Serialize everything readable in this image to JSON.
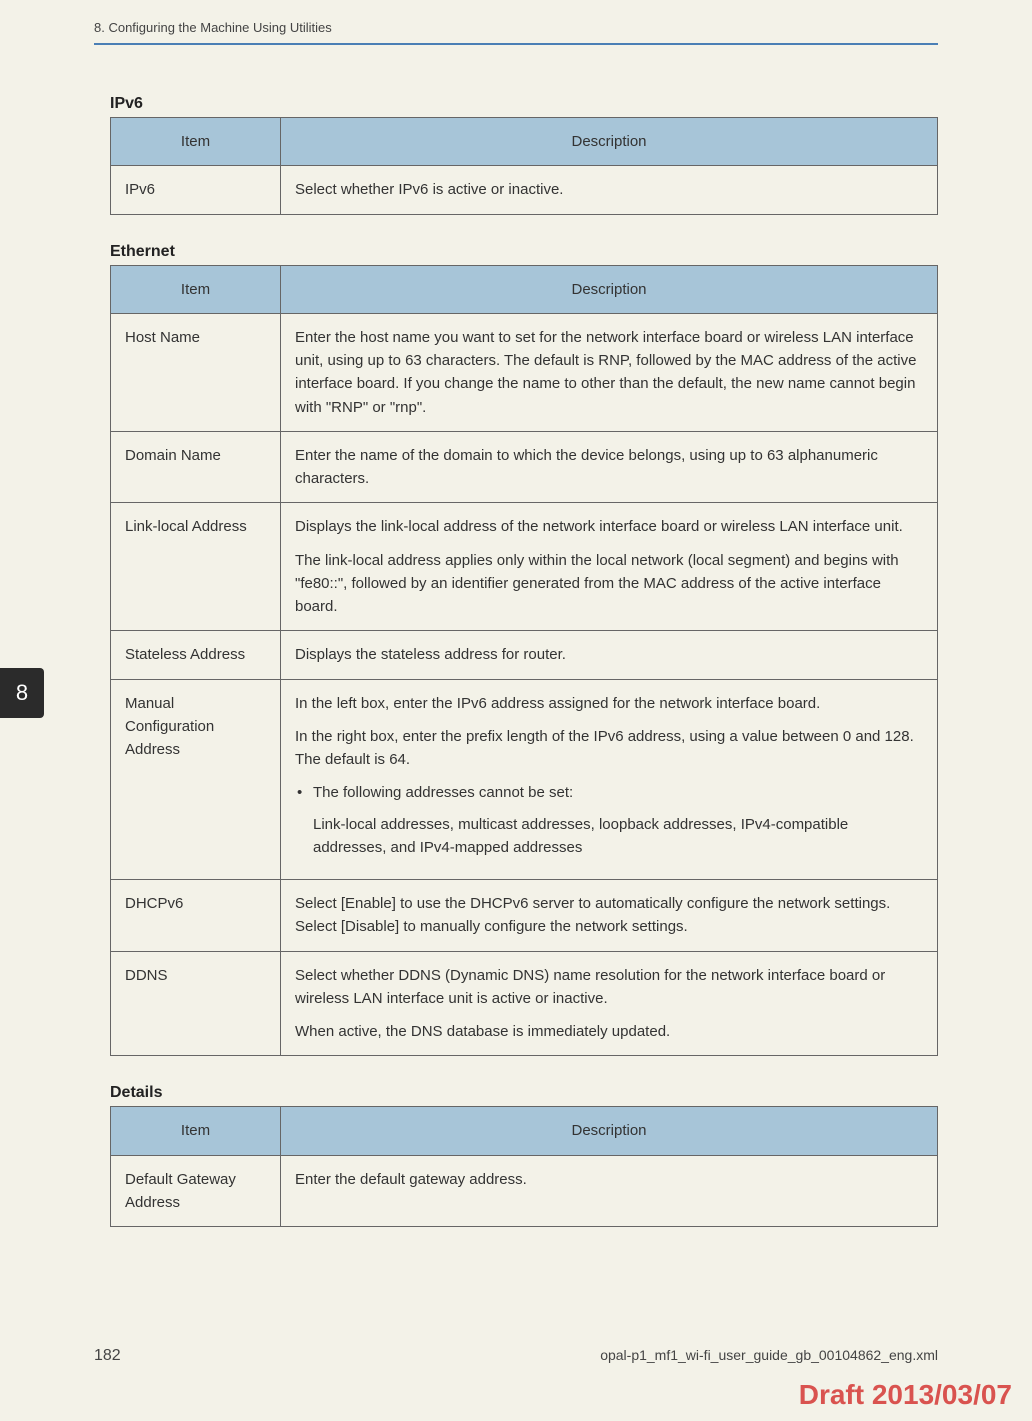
{
  "header": {
    "chapter": "8. Configuring the Machine Using Utilities"
  },
  "sideTab": {
    "number": "8"
  },
  "sections": {
    "ipv6": {
      "title": "IPv6",
      "headers": {
        "item": "Item",
        "description": "Description"
      },
      "rows": [
        {
          "item": "IPv6",
          "description": "Select whether IPv6 is active or inactive."
        }
      ]
    },
    "ethernet": {
      "title": "Ethernet",
      "headers": {
        "item": "Item",
        "description": "Description"
      },
      "rows": [
        {
          "item": "Host Name",
          "description": "Enter the host name you want to set for the network interface board or wireless LAN interface unit, using up to 63 characters. The default is RNP, followed by the MAC address of the active interface board. If you change the name to other than the default, the new name cannot begin with \"RNP\" or \"rnp\"."
        },
        {
          "item": "Domain Name",
          "description": "Enter the name of the domain to which the device belongs, using up to 63 alphanumeric characters."
        },
        {
          "item": "Link-local Address",
          "description_p1": "Displays the link-local address of the network interface board or wireless LAN interface unit.",
          "description_p2": "The link-local address applies only within the local network (local segment) and begins with \"fe80::\", followed by an identifier generated from the MAC address of the active interface board."
        },
        {
          "item": "Stateless Address",
          "description": "Displays the stateless address for router."
        },
        {
          "item": "Manual Configuration Address",
          "description_p1": "In the left box, enter the IPv6 address assigned for the network interface board.",
          "description_p2": "In the right box, enter the prefix length of the IPv6 address, using a value between 0 and 128. The default is 64.",
          "bullet": "The following addresses cannot be set:",
          "bullet_sub": "Link-local addresses, multicast addresses, loopback addresses, IPv4-compatible addresses, and IPv4-mapped addresses"
        },
        {
          "item": "DHCPv6",
          "description": "Select [Enable] to use the DHCPv6 server to automatically configure the network settings. Select [Disable] to manually configure the network settings."
        },
        {
          "item": "DDNS",
          "description_p1": "Select whether DDNS (Dynamic DNS) name resolution for the network interface board or wireless LAN interface unit is active or inactive.",
          "description_p2": "When active, the DNS database is immediately updated."
        }
      ]
    },
    "details": {
      "title": "Details",
      "headers": {
        "item": "Item",
        "description": "Description"
      },
      "rows": [
        {
          "item": "Default Gateway Address",
          "description": "Enter the default gateway address."
        }
      ]
    }
  },
  "footer": {
    "pageNumber": "182",
    "filename": "opal-p1_mf1_wi-fi_user_guide_gb_00104862_eng.xml"
  },
  "draft": {
    "text": "Draft 2013/03/07"
  }
}
